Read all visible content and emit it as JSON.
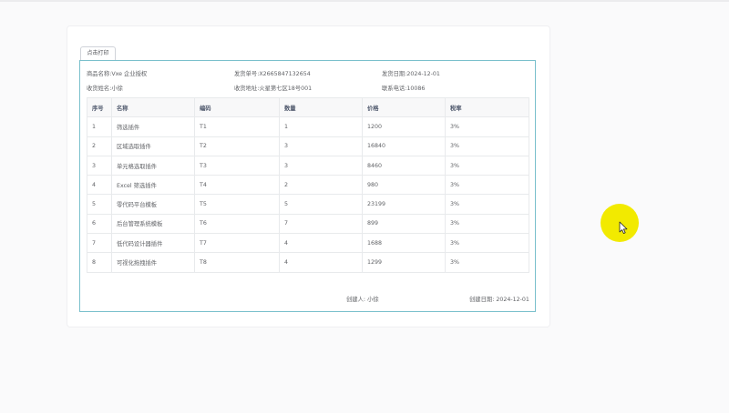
{
  "toolbar": {
    "print_label": "点击打印"
  },
  "info": [
    {
      "label": "商品名称:",
      "value": "Vxe 企业授权"
    },
    {
      "label": "发货单号:",
      "value": "X2665847132654"
    },
    {
      "label": "发货日期:",
      "value": "2024-12-01"
    },
    {
      "label": "收货姓名:",
      "value": "小徐"
    },
    {
      "label": "收货地址:",
      "value": "火星第七区18号001"
    },
    {
      "label": "联系电话:",
      "value": "10086"
    }
  ],
  "table": {
    "headers": [
      "序号",
      "名称",
      "编码",
      "数量",
      "价格",
      "税率"
    ],
    "rows": [
      [
        "1",
        "筛选插件",
        "T1",
        "1",
        "1200",
        "3%"
      ],
      [
        "2",
        "区域选取插件",
        "T2",
        "3",
        "16840",
        "3%"
      ],
      [
        "3",
        "单元格选取插件",
        "T3",
        "3",
        "8460",
        "3%"
      ],
      [
        "4",
        "Excel 筛选插件",
        "T4",
        "2",
        "980",
        "3%"
      ],
      [
        "5",
        "零代码平台模板",
        "T5",
        "5",
        "23199",
        "3%"
      ],
      [
        "6",
        "后台管理系统模板",
        "T6",
        "7",
        "899",
        "3%"
      ],
      [
        "7",
        "低代码设计器插件",
        "T7",
        "4",
        "1688",
        "3%"
      ],
      [
        "8",
        "可视化拖拽插件",
        "T8",
        "4",
        "1299",
        "3%"
      ]
    ]
  },
  "footer": {
    "creator_label": "创建人:",
    "creator_value": "小徐",
    "date_label": "创建日期:",
    "date_value": "2024-12-01"
  },
  "colors": {
    "print_border": "#7ac0cc",
    "cursor_highlight": "#f2ea00"
  },
  "icons": {
    "cursor": "mouse-pointer-icon"
  }
}
